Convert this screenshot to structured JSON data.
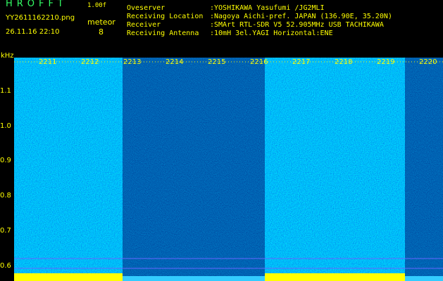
{
  "header": {
    "app_name": "HROFFT",
    "version": "1.00f",
    "filename": "YY2611162210.png",
    "datetime": "26.11.16 22:10",
    "meteor_label": "meteor",
    "meteor_count": "8"
  },
  "info": {
    "rows": [
      {
        "label": "Oveserver",
        "value": ":YOSHIKAWA Yasufumi /JG2MLI"
      },
      {
        "label": "Receiving Location",
        "value": ":Nagoya Aichi-pref. JAPAN (136.90E, 35.20N)"
      },
      {
        "label": "Receiver",
        "value": ":SMArt RTL-SDR V5 52.905MHz USB TACHIKAWA"
      },
      {
        "label": "Receiving Antenna",
        "value": ":10mH 3el.YAGI Horizontal:ENE"
      }
    ]
  },
  "colors": {
    "background": "#000000",
    "label": "#ffff00",
    "title": "#33ff66",
    "info": "#66ffff",
    "spectrum_low": "#000080",
    "spectrum_high": "#00ffff"
  },
  "spectrogram": {
    "y_axis_label": "kHz",
    "y_ticks": [
      "1.1",
      "1.0",
      "0.9",
      "0.8",
      "0.7",
      "0.6"
    ],
    "x_ticks": [
      "2211",
      "2212",
      "2213",
      "2214",
      "2215",
      "2216",
      "2217",
      "2218",
      "2219",
      "2220"
    ]
  }
}
